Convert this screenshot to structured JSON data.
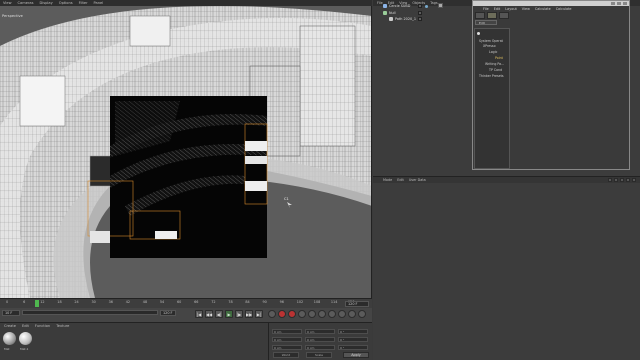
{
  "menubar": {
    "items": [
      "View",
      "Cameras",
      "Display",
      "Options",
      "Filter",
      "Panel"
    ]
  },
  "viewport": {
    "label": "Perspective",
    "overlay_label": "C1"
  },
  "timeline": {
    "ruler_ticks": [
      "0",
      "6",
      "12",
      "18",
      "24",
      "30",
      "36",
      "42",
      "48",
      "54",
      "60",
      "66",
      "72",
      "78",
      "84",
      "90",
      "96",
      "102",
      "108",
      "114",
      "120"
    ],
    "current_frame": "10 F",
    "start_frame": "0 F",
    "end_frame": "120 F",
    "range_end": "120 F",
    "playhead_frame": 10,
    "transport": [
      "|◀",
      "◀◀",
      "◀|",
      "▶",
      "|▶",
      "▶▶",
      "▶|"
    ]
  },
  "material": {
    "menu": [
      "Create",
      "Edit",
      "Function",
      "Texture"
    ],
    "materials": [
      "Mat",
      "Mat.1"
    ]
  },
  "coords": {
    "rows": [
      [
        "X",
        "0 cm",
        "X",
        "0 cm",
        "H",
        "0 °"
      ],
      [
        "Y",
        "0 cm",
        "Y",
        "0 cm",
        "P",
        "0 °"
      ],
      [
        "Z",
        "0 cm",
        "Z",
        "0 cm",
        "B",
        "0 °"
      ]
    ],
    "world_label": "World",
    "scale_label": "Scale",
    "apply_label": "Apply"
  },
  "object_manager": {
    "menu": [
      "File",
      "Edit",
      "View",
      "Objects",
      "Tags"
    ],
    "objects": [
      "Cercle SUBD",
      "Null",
      "Path 2020_1"
    ]
  },
  "xpresso": {
    "menu": [
      "File",
      "Edit",
      "Layout",
      "View",
      "Calculate",
      "Calculate"
    ],
    "tabs": [
      "Edit"
    ],
    "tree": [
      "System Operat",
      "XPresso",
      "Logic",
      "Point",
      "Writing Pa...",
      "TP Cond",
      "Thinker Presets"
    ]
  },
  "attributes": {
    "menu": [
      "Mode",
      "Edit",
      "User Data"
    ]
  }
}
